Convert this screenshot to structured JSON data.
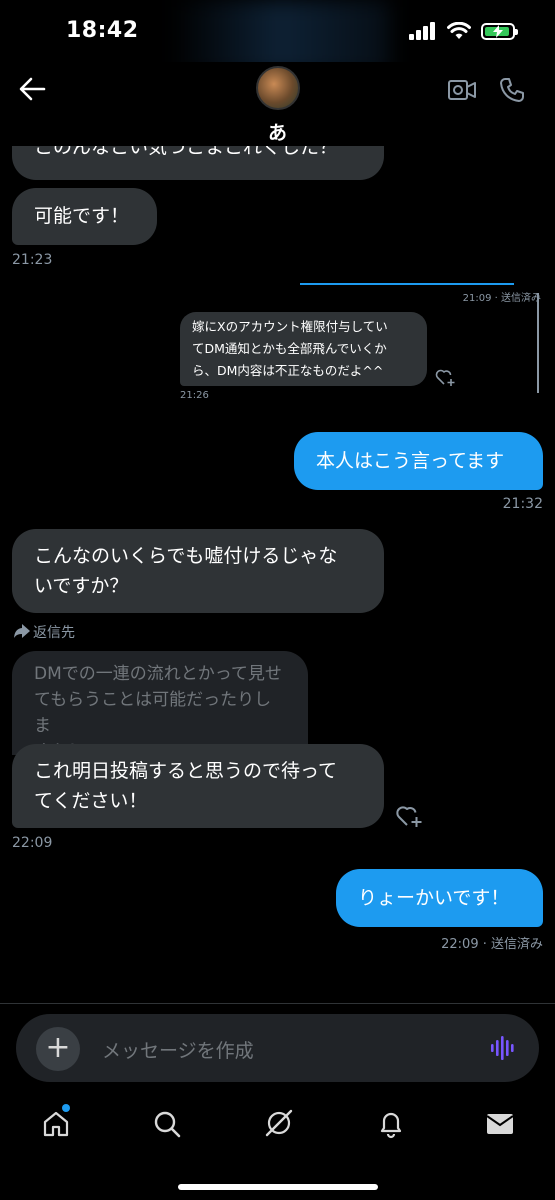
{
  "status": {
    "time": "18:42"
  },
  "header": {
    "contact_name": "あ"
  },
  "messages": {
    "partial_text": "このんなこい気づこまこれくした？",
    "m1_text": "可能です！",
    "m1_time": "21:23",
    "quoted_tweet": {
      "time_sent": "21:09 · 送信済み",
      "line1": "嫁にXのアカウント権限付与してい",
      "line2": "てDM通知とかも全部飛んでいくか",
      "line3": "ら、DM内容は不正なものだよ^^",
      "time": "21:26"
    },
    "m2_text": "本人はこう言ってます",
    "m2_time": "21:32",
    "m3_line1": "こんなのいくらでも嘘付けるじゃな",
    "m3_line2": "いですか？",
    "reply_label": "返信先",
    "reply_quote_line1": "DMでの一連の流れとかって見せ",
    "reply_quote_line2": "てもらうことは可能だったりしま",
    "reply_quote_line3": "すか？",
    "m4_line1": "これ明日投稿すると思うので待って",
    "m4_line2": "てください！",
    "m4_time": "22:09",
    "m5_text": "りょーかいです！",
    "m5_time": "22:09 · 送信済み"
  },
  "composer": {
    "placeholder": "メッセージを作成"
  },
  "colors": {
    "accent": "#1d9bf0",
    "incoming_bubble": "#2f3336",
    "background": "#000000",
    "voice_icon": "#7856ff"
  }
}
